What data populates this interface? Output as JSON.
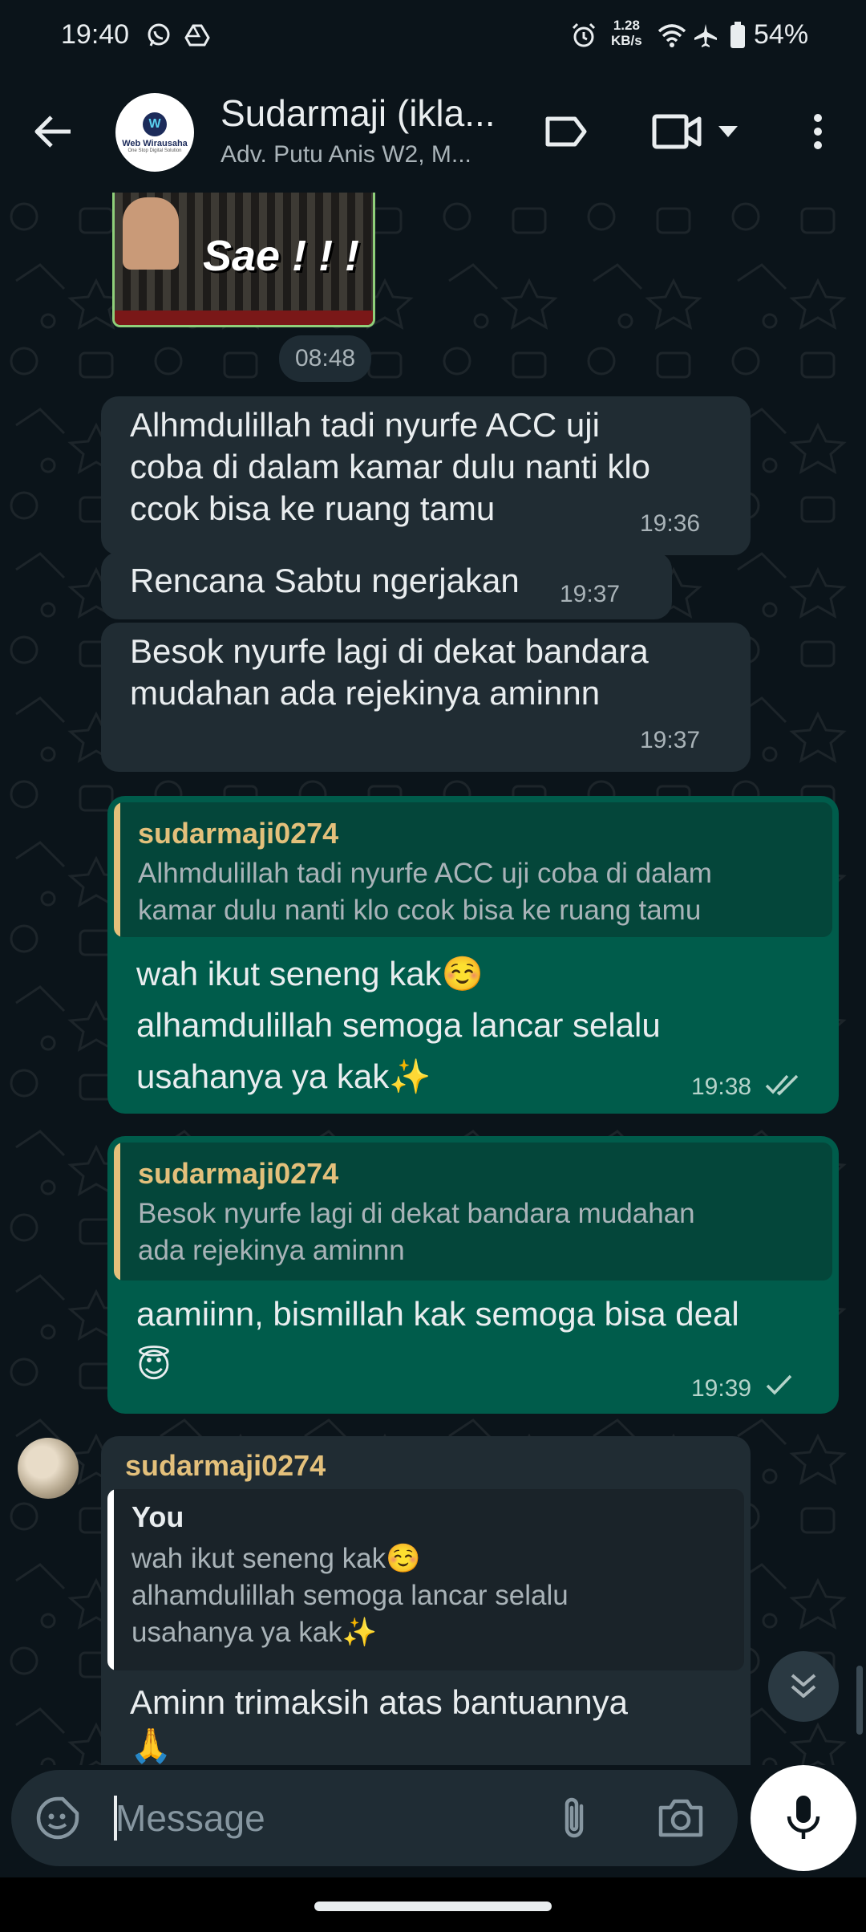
{
  "status_bar": {
    "time": "19:40",
    "net_speed_value": "1.28",
    "net_speed_unit": "KB/s",
    "battery": "54%",
    "icons": [
      "whatsapp-icon",
      "drive-icon",
      "alarm-icon",
      "wifi-icon",
      "airplane-icon",
      "battery-icon"
    ]
  },
  "header": {
    "title": "Sudarmaji (ikla...",
    "subtitle": "Adv. Putu Anis W2, M...",
    "avatar_logo_name": "Web Wirausaha",
    "avatar_logo_tag": "One Stop Digital Solution",
    "icons": [
      "back-arrow-icon",
      "label-icon",
      "video-call-icon",
      "chevron-down-icon",
      "more-vert-icon"
    ]
  },
  "messages": {
    "sticker": {
      "text": "Sae ! ! !",
      "time": "08:48"
    },
    "m1": {
      "lines": [
        "Alhmdulillah tadi nyurfe ACC uji",
        "coba di dalam kamar dulu nanti klo",
        "ccok bisa ke ruang tamu"
      ],
      "time": "19:36"
    },
    "m2": {
      "lines": [
        "Rencana Sabtu ngerjakan"
      ],
      "time": "19:37"
    },
    "m3": {
      "lines": [
        "Besok nyurfe lagi di dekat bandara",
        "mudahan ada rejekinya aminnn"
      ],
      "time": "19:37"
    },
    "m4": {
      "quote_name": "sudarmaji0274",
      "quote_lines": [
        "Alhmdulillah tadi nyurfe ACC uji coba di dalam",
        "kamar dulu nanti klo ccok bisa ke ruang tamu"
      ],
      "lines": [
        "wah ikut seneng kak☺️",
        "alhamdulillah semoga lancar selalu",
        "usahanya ya kak✨"
      ],
      "time": "19:38",
      "status": "read"
    },
    "m5": {
      "quote_name": "sudarmaji0274",
      "quote_lines": [
        "Besok nyurfe lagi di dekat bandara mudahan",
        "ada rejekinya aminnn"
      ],
      "lines": [
        "aamiinn, bismillah kak semoga bisa deal",
        "😇"
      ],
      "time": "19:39",
      "status": "sent"
    },
    "m6": {
      "sender": "sudarmaji0274",
      "quote_name": "You",
      "quote_lines": [
        "wah ikut seneng kak☺️",
        "alhamdulillah semoga lancar selalu",
        "usahanya ya kak✨"
      ],
      "lines": [
        "Aminn trimaksih atas bantuannya",
        "🙏"
      ]
    }
  },
  "composer": {
    "placeholder": "Message",
    "icons": [
      "sticker-icon",
      "attach-icon",
      "camera-icon",
      "mic-icon"
    ]
  },
  "colors": {
    "background": "#0b141a",
    "incoming_bubble": "#202c33",
    "outgoing_bubble": "#005c4b",
    "quote_accent": "#e3c07b",
    "quote_you_accent": "#ffffff"
  }
}
